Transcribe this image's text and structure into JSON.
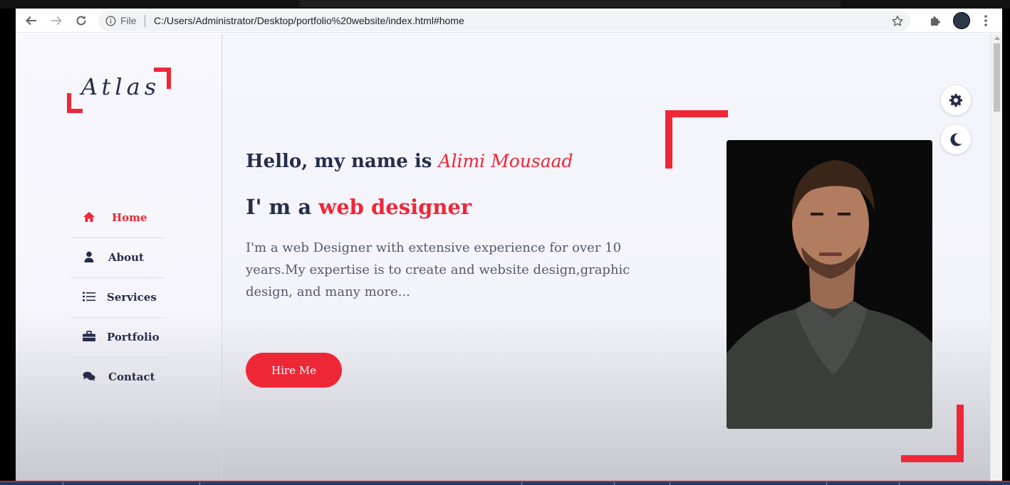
{
  "browser": {
    "page_info_label": "File",
    "url": "C:/Users/Administrator/Desktop/portfolio%20website/index.html#home"
  },
  "logo": {
    "text": "Atlas"
  },
  "menu": {
    "items": [
      {
        "label": "Home",
        "icon": "home-icon",
        "active": true
      },
      {
        "label": "About",
        "icon": "user-icon",
        "active": false
      },
      {
        "label": "Services",
        "icon": "list-icon",
        "active": false
      },
      {
        "label": "Portfolio",
        "icon": "briefcase-icon",
        "active": false
      },
      {
        "label": "Contact",
        "icon": "comments-icon",
        "active": false
      }
    ]
  },
  "hero": {
    "greeting": "Hello, my name is",
    "name": "Alimi Mousaad",
    "role_prefix": "I' m a",
    "role": "web designer",
    "bio": "I'm a web Designer with extensive experience for over 10 years.My expertise is to create and website design,graphic design, and many more...",
    "cta": "Hire Me"
  },
  "colors": {
    "accent": "#ee2737",
    "text": "#262d4a",
    "muted": "#55596a",
    "background": "#f5f5fc"
  },
  "controls": {
    "settings_icon": "gear-icon",
    "theme_icon": "moon-icon"
  }
}
